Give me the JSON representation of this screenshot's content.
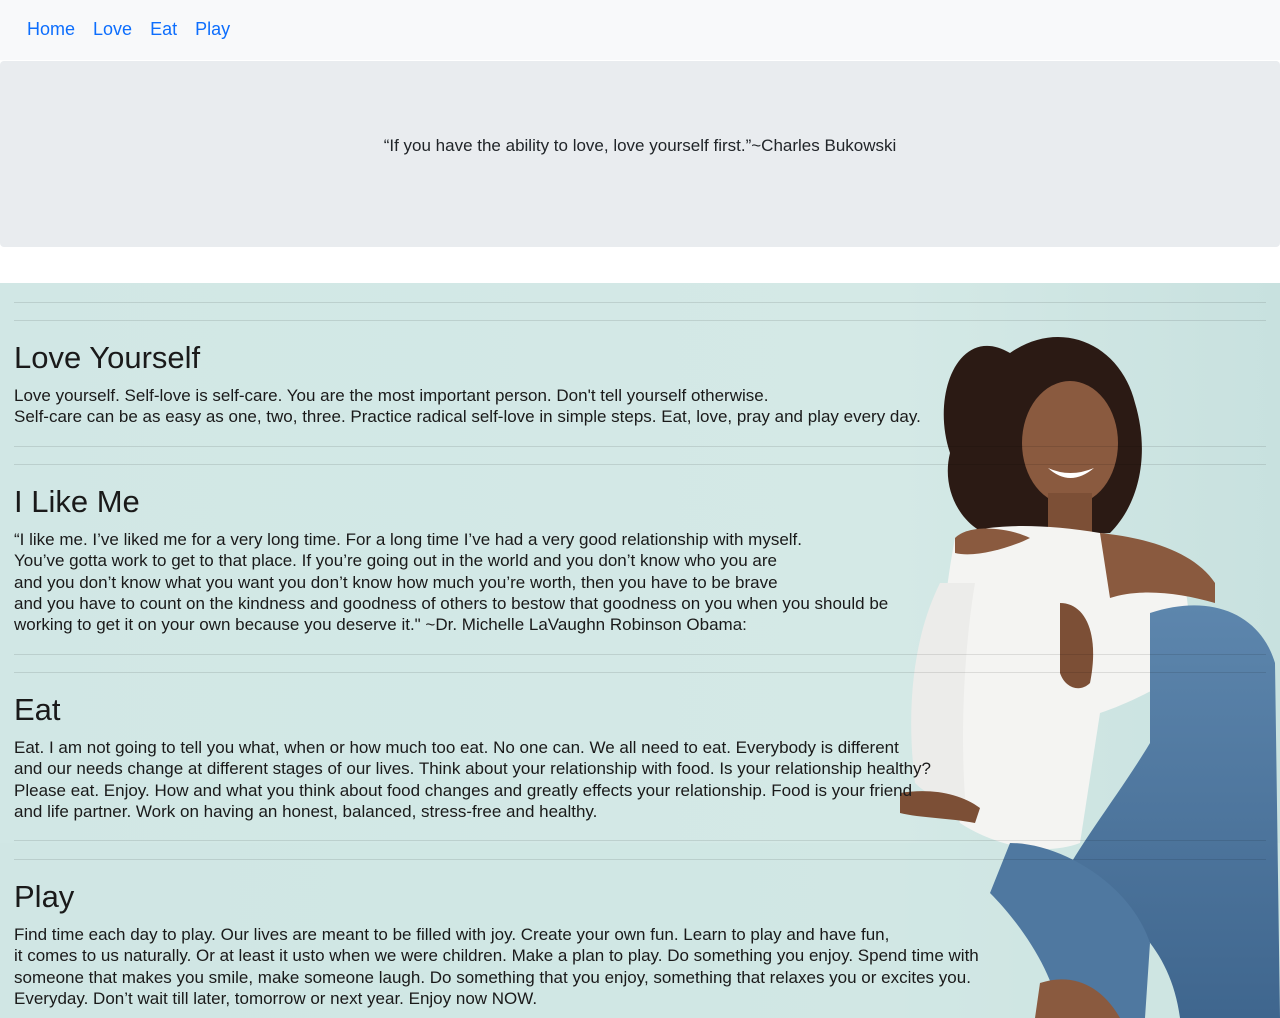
{
  "nav": {
    "items": [
      {
        "label": "Home"
      },
      {
        "label": "Love"
      },
      {
        "label": "Eat"
      },
      {
        "label": "Play"
      }
    ]
  },
  "banner": {
    "quote": "“If you have the ability to love, love yourself first.”~Charles Bukowski"
  },
  "sections": [
    {
      "title": "Love Yourself",
      "lines": [
        "Love yourself. Self-love is self-care. You are the most important person. Don't tell yourself otherwise.",
        "Self-care can be as easy as one, two, three. Practice radical self-love in simple steps. Eat, love, pray and play every day."
      ]
    },
    {
      "title": "I Like Me",
      "lines": [
        "“I like me. I’ve liked me for a very long time. For a long time I’ve had a very good relationship with myself.",
        "You’ve gotta work to get to that place. If you’re going out in the world and you don’t know who you are",
        "and you don’t know what you want you don’t know how much you’re worth, then you have to be brave",
        "and you have to count on the kindness and goodness of others to bestow that goodness on you when you should be",
        "working to get it on your own because you deserve it.\" ~Dr. Michelle LaVaughn Robinson Obama:"
      ]
    },
    {
      "title": "Eat",
      "lines": [
        "Eat. I am not going to tell you what, when or how much too eat. No one can. We all need to eat. Everybody is different",
        "and our needs change at different stages of our lives. Think about your relationship with food. Is your relationship healthy?",
        "Please eat. Enjoy. How and what you think about food changes and greatly effects your relationship. Food is your friend",
        "and life partner. Work on having an honest, balanced, stress-free and healthy."
      ]
    },
    {
      "title": "Play",
      "lines": [
        "Find time each day to play. Our lives are meant to be filled with joy. Create your own fun. Learn to play and have fun,",
        "it comes to us naturally. Or at least it usto when we were children. Make a plan to play. Do something you enjoy. Spend time with",
        "someone that makes you smile, make someone laugh. Do something that you enjoy, something that relaxes you or excites you.",
        "Everyday. Don’t wait till later, tomorrow or next year. Enjoy now NOW."
      ]
    }
  ],
  "colors": {
    "nav_bg": "#f8f9fa",
    "link": "#0d6efd",
    "banner_bg": "#e9ecef",
    "content_bg": "#d3e8e6"
  }
}
